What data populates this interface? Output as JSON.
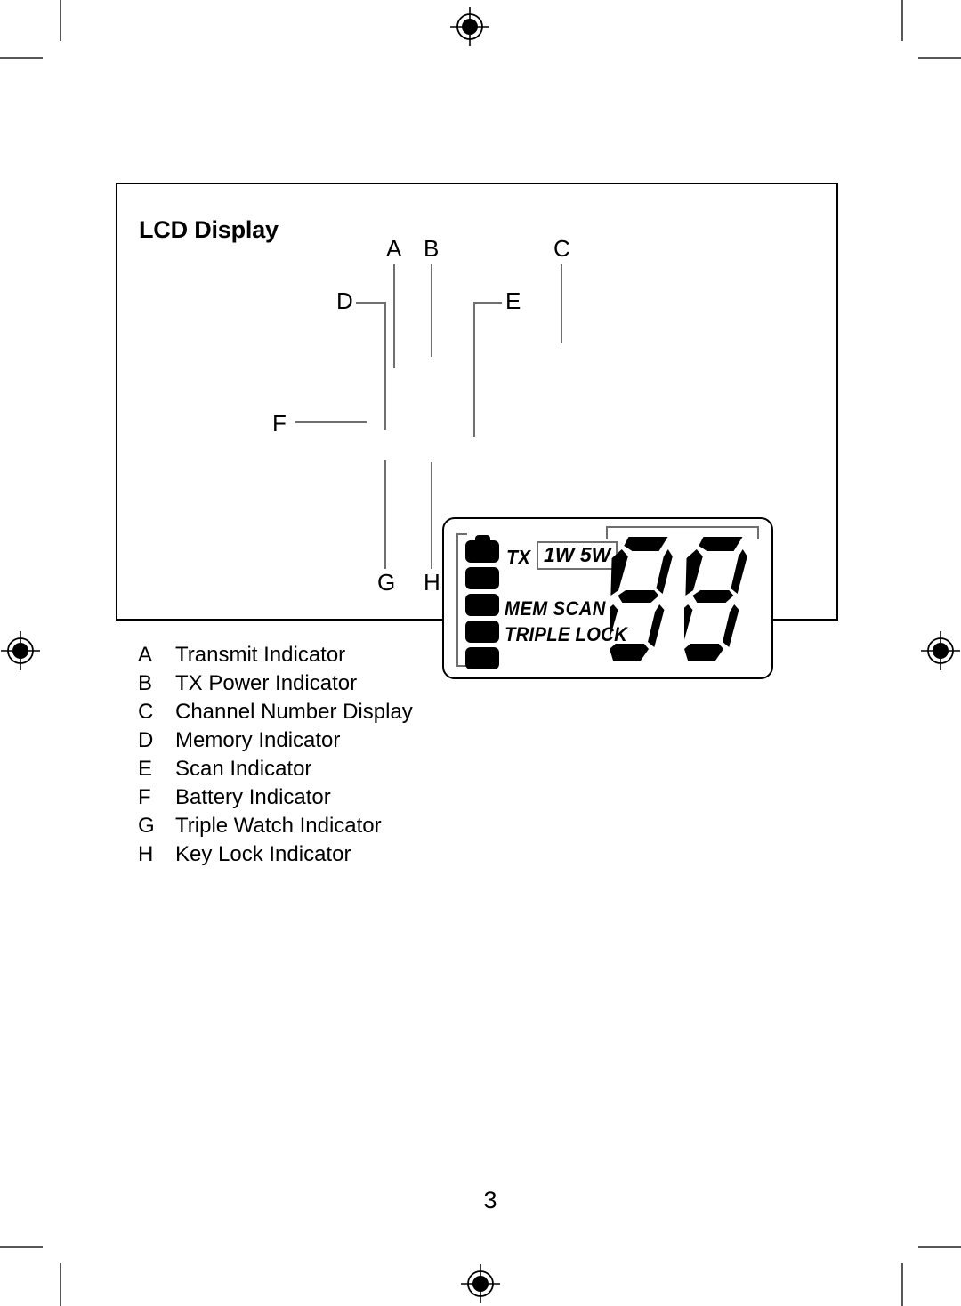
{
  "page": {
    "title": "LCD Display",
    "number": "3"
  },
  "callouts": {
    "a": "A",
    "b": "B",
    "c": "C",
    "d": "D",
    "e": "E",
    "f": "F",
    "g": "G",
    "h": "H"
  },
  "lcd": {
    "tx_label": "TX",
    "tx_power": "1W 5W",
    "mem_scan": "MEM  SCAN",
    "triple_lock": "TRIPLE LOCK",
    "channel_digits": "88",
    "battery_segments": 5,
    "segment_color": "#000000",
    "leader_color": "#6f6f71"
  },
  "legend": {
    "items": [
      {
        "key": "A",
        "label": "Transmit Indicator"
      },
      {
        "key": "B",
        "label": "TX Power Indicator"
      },
      {
        "key": "C",
        "label": "Channel Number Display"
      },
      {
        "key": "D",
        "label": "Memory Indicator"
      },
      {
        "key": "E",
        "label": "Scan Indicator"
      },
      {
        "key": "F",
        "label": "Battery Indicator"
      },
      {
        "key": "G",
        "label": "Triple Watch Indicator"
      },
      {
        "key": "H",
        "label": "Key Lock Indicator"
      }
    ]
  }
}
